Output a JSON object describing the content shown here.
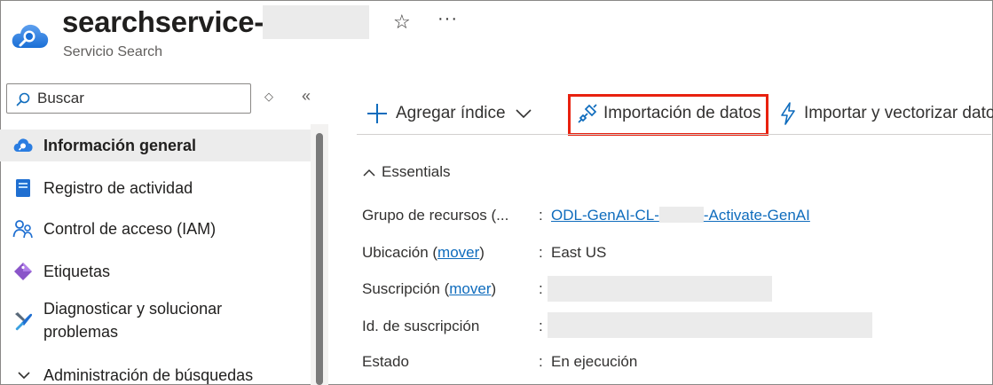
{
  "header": {
    "title": "searchservice-",
    "subtitle": "Servicio Search",
    "favorite_icon": "star-icon",
    "more_glyph": "···"
  },
  "sidebar": {
    "search": {
      "placeholder": "Buscar"
    },
    "sort_glyph": "◇",
    "collapse_glyph": "«",
    "items": [
      {
        "label": "Información general",
        "icon": "overview-cloud-icon",
        "active": true
      },
      {
        "label": "Registro de actividad",
        "icon": "activity-log-icon"
      },
      {
        "label": "Control de acceso (IAM)",
        "icon": "people-icon"
      },
      {
        "label": "Etiquetas",
        "icon": "tag-icon"
      },
      {
        "label": "Diagnosticar y solucionar problemas",
        "icon": "wrench-icon"
      },
      {
        "label": "Administración de búsquedas",
        "icon": "chevron-down-icon"
      }
    ]
  },
  "toolbar": {
    "add_index": "Agregar índice",
    "import_data": "Importación de datos",
    "import_vectorize": "Importar y vectorizar datos",
    "highlight_color": "#e8210f"
  },
  "essentials": {
    "label": "Essentials",
    "properties": [
      {
        "label": "Grupo de recursos (...",
        "value_pre": "ODL-GenAI-CL-",
        "value_post": "-Activate-GenAI",
        "link": true
      },
      {
        "label_pre": "Ubicación (",
        "label_link": "mover",
        "label_post": ")",
        "value": "East US"
      },
      {
        "label_pre": "Suscripción (",
        "label_link": "mover",
        "label_post": ")",
        "value": ""
      },
      {
        "label": "Id. de suscripción",
        "value": ""
      },
      {
        "label": "Estado",
        "value": "En ejecución"
      }
    ],
    "separator": ":"
  },
  "colors": {
    "link": "#0f6cbd",
    "accent": "#0078d4"
  }
}
